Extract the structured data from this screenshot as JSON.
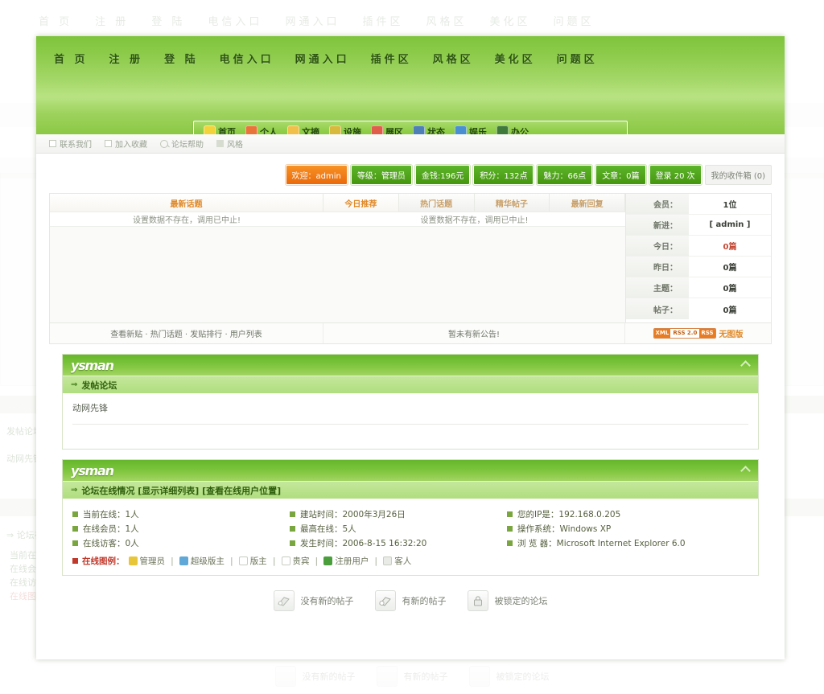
{
  "top_nav": {
    "items": [
      "首 页",
      "注 册",
      "登 陆",
      "电信入口",
      "网通入口",
      "插件区",
      "风格区",
      "美化区",
      "问题区"
    ]
  },
  "icon_nav": {
    "items": [
      {
        "label": "首页",
        "icon": "home-icon",
        "color": "#f2d33a"
      },
      {
        "label": "个人",
        "icon": "person-icon",
        "color": "#e8743a"
      },
      {
        "label": "文摘",
        "icon": "document-icon",
        "color": "#f0c04a"
      },
      {
        "label": "设施",
        "icon": "tools-icon",
        "color": "#d8b93c"
      },
      {
        "label": "展区",
        "icon": "gallery-icon",
        "color": "#e05d4a"
      },
      {
        "label": "状态",
        "icon": "status-icon",
        "color": "#4e7fb5"
      },
      {
        "label": "娱乐",
        "icon": "entertainment-icon",
        "color": "#4a8fd0"
      },
      {
        "label": "办公",
        "icon": "office-icon",
        "color": "#3f7a3a"
      }
    ]
  },
  "sub_bar": {
    "items": [
      {
        "label": "联系我们",
        "icon": "checkbox-icon"
      },
      {
        "label": "加入收藏",
        "icon": "checkbox-icon"
      },
      {
        "label": "论坛帮助",
        "icon": "magnifier-icon"
      },
      {
        "label": "风格",
        "icon": "swatch-icon"
      }
    ]
  },
  "user_strip": {
    "chips": [
      {
        "label": "欢迎：admin",
        "style": "orange"
      },
      {
        "label": "等级：管理员",
        "style": "green"
      },
      {
        "label": "金钱:196元",
        "style": "green"
      },
      {
        "label": "积分：132点",
        "style": "green"
      },
      {
        "label": "魅力：66点",
        "style": "green"
      },
      {
        "label": "文章：0篇",
        "style": "green"
      },
      {
        "label": "登录 20 次",
        "style": "green"
      },
      {
        "label": "我的收件箱 (0)",
        "style": "plain"
      }
    ]
  },
  "tabs": {
    "left": {
      "label": "最新话题",
      "active": true
    },
    "right": [
      {
        "label": "今日推荐",
        "active": true
      },
      {
        "label": "热门话题",
        "active": false
      },
      {
        "label": "精华帖子",
        "active": false
      },
      {
        "label": "最新回复",
        "active": false
      }
    ]
  },
  "tab_content": {
    "left_message": "设置数据不存在，调用已中止!",
    "right_message": "设置数据不存在，调用已中止!"
  },
  "stats": {
    "rows": [
      {
        "label": "会员：",
        "value": "1位",
        "red": false
      },
      {
        "label": "新进：",
        "value": "[ admin ]",
        "red": false
      },
      {
        "label": "今日：",
        "value": "0篇",
        "red": true
      },
      {
        "label": "昨日：",
        "value": "0篇",
        "red": false
      },
      {
        "label": "主题：",
        "value": "0篇",
        "red": false
      },
      {
        "label": "帖子：",
        "value": "0篇",
        "red": false
      }
    ]
  },
  "foot_strip": {
    "links": "查看新贴 · 热门话题 · 发贴排行 · 用户列表",
    "notice": "暂未有新公告!",
    "rss_left_tag": "XML",
    "rss_mid": "RSS 2.0",
    "rss_right_tag": "RSS",
    "nopic": "无图版"
  },
  "forum_card": {
    "logo": "ysman",
    "title": "发帖论坛",
    "arrow": "⇒",
    "item": "动网先锋"
  },
  "online_card": {
    "logo": "ysman",
    "arrow": "⇒",
    "title": "论坛在线情况 [显示详细列表] [查看在线用户位置]",
    "col1": [
      "当前在线：1人",
      "在线会员：1人",
      "在线访客：0人"
    ],
    "col2": [
      "建站时间：2000年3月26日",
      "最高在线：5人",
      "发生时间：2006-8-15 16:32:20"
    ],
    "col3": [
      "您的IP是：192.168.0.205",
      "操作系统：Windows XP",
      "浏 览 器：Microsoft Internet Explorer 6.0"
    ],
    "legend_title": "在线图例：",
    "legend_items": [
      {
        "label": "管理员",
        "color": "#e8c63a"
      },
      {
        "label": "超级版主",
        "color": "#5fa8d8"
      },
      {
        "label": "版主",
        "color": "#ffffff"
      },
      {
        "label": "贵宾",
        "color": "#ffffff"
      },
      {
        "label": "注册用户",
        "color": "#4b9e3c"
      },
      {
        "label": "客人",
        "color": "#9aa293"
      }
    ]
  },
  "bottom_legend": {
    "items": [
      {
        "label": "没有新的帖子",
        "icon": "folder-no-new-icon"
      },
      {
        "label": "有新的帖子",
        "icon": "folder-new-icon"
      },
      {
        "label": "被锁定的论坛",
        "icon": "lock-icon"
      }
    ]
  }
}
